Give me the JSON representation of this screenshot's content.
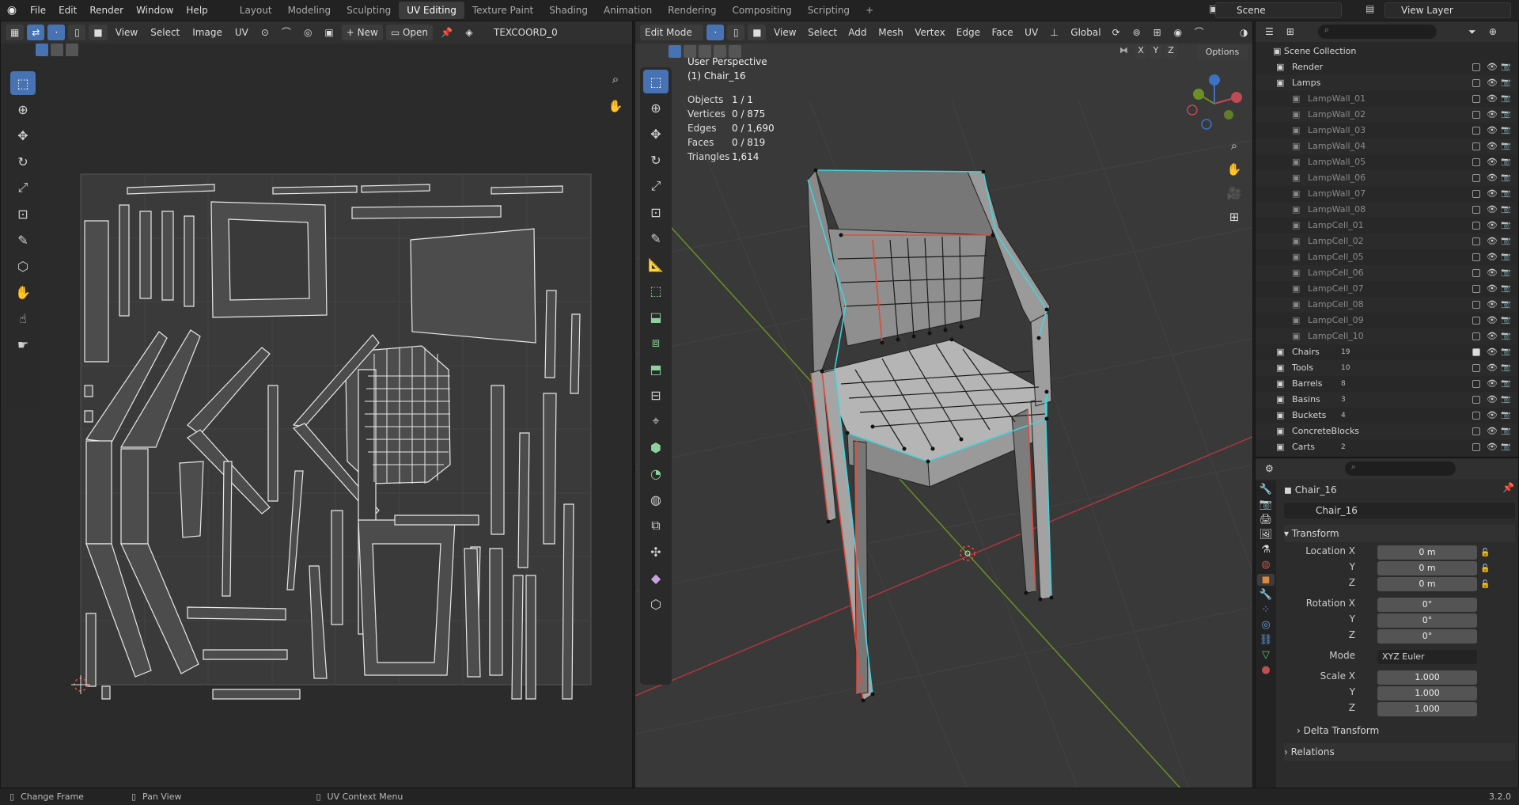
{
  "topbar": {
    "menus": [
      "File",
      "Edit",
      "Render",
      "Window",
      "Help"
    ],
    "workspaces": [
      "Layout",
      "Modeling",
      "Sculpting",
      "UV Editing",
      "Texture Paint",
      "Shading",
      "Animation",
      "Rendering",
      "Compositing",
      "Scripting"
    ],
    "active_workspace": "UV Editing",
    "add_tab": "+",
    "scene": "Scene",
    "view_layer": "View Layer"
  },
  "uv_editor": {
    "menus": [
      "View",
      "Select",
      "Image",
      "UV"
    ],
    "new_label": "New",
    "open_label": "Open",
    "uv_map": "TEXCOORD_0"
  },
  "viewport": {
    "mode": "Edit Mode",
    "menus": [
      "View",
      "Select",
      "Add",
      "Mesh",
      "Vertex",
      "Edge",
      "Face",
      "UV"
    ],
    "orientation": "Global",
    "axes": [
      "X",
      "Y",
      "Z"
    ],
    "options_label": "Options",
    "view_name": "User Perspective",
    "object_name": "(1) Chair_16",
    "stats": [
      {
        "label": "Objects",
        "value": "1 / 1"
      },
      {
        "label": "Vertices",
        "value": "0 / 875"
      },
      {
        "label": "Edges",
        "value": "0 / 1,690"
      },
      {
        "label": "Faces",
        "value": "0 / 819"
      },
      {
        "label": "Triangles",
        "value": "1,614"
      }
    ]
  },
  "outliner": {
    "title": "Scene Collection",
    "items": [
      {
        "label": "Render",
        "indent": 1,
        "count": "",
        "checked": false
      },
      {
        "label": "Lamps",
        "indent": 1,
        "count": "",
        "checked": false
      },
      {
        "label": "LampWall_01",
        "indent": 2,
        "count": "",
        "checked": false
      },
      {
        "label": "LampWall_02",
        "indent": 2,
        "count": "",
        "checked": false
      },
      {
        "label": "LampWall_03",
        "indent": 2,
        "count": "",
        "checked": false
      },
      {
        "label": "LampWall_04",
        "indent": 2,
        "count": "",
        "checked": false
      },
      {
        "label": "LampWall_05",
        "indent": 2,
        "count": "",
        "checked": false
      },
      {
        "label": "LampWall_06",
        "indent": 2,
        "count": "",
        "checked": false
      },
      {
        "label": "LampWall_07",
        "indent": 2,
        "count": "",
        "checked": false
      },
      {
        "label": "LampWall_08",
        "indent": 2,
        "count": "",
        "checked": false
      },
      {
        "label": "LampCell_01",
        "indent": 2,
        "count": "",
        "checked": false
      },
      {
        "label": "LampCell_02",
        "indent": 2,
        "count": "",
        "checked": false
      },
      {
        "label": "LampCell_05",
        "indent": 2,
        "count": "",
        "checked": false
      },
      {
        "label": "LampCell_06",
        "indent": 2,
        "count": "",
        "checked": false
      },
      {
        "label": "LampCell_07",
        "indent": 2,
        "count": "",
        "checked": false
      },
      {
        "label": "LampCell_08",
        "indent": 2,
        "count": "",
        "checked": false
      },
      {
        "label": "LampCell_09",
        "indent": 2,
        "count": "",
        "checked": false
      },
      {
        "label": "LampCell_10",
        "indent": 2,
        "count": "",
        "checked": false
      },
      {
        "label": "Chairs",
        "indent": 1,
        "count": "19",
        "checked": true
      },
      {
        "label": "Tools",
        "indent": 1,
        "count": "10",
        "checked": false
      },
      {
        "label": "Barrels",
        "indent": 1,
        "count": "8",
        "checked": false
      },
      {
        "label": "Basins",
        "indent": 1,
        "count": "3",
        "checked": false
      },
      {
        "label": "Buckets",
        "indent": 1,
        "count": "4",
        "checked": false
      },
      {
        "label": "ConcreteBlocks",
        "indent": 1,
        "count": "",
        "checked": false
      },
      {
        "label": "Carts",
        "indent": 1,
        "count": "2",
        "checked": false
      }
    ]
  },
  "properties": {
    "object_title": "Chair_16",
    "object_field": "Chair_16",
    "transform_label": "Transform",
    "location_label": "Location X",
    "location": [
      "0 m",
      "0 m",
      "0 m"
    ],
    "rotation_label": "Rotation X",
    "rotation": [
      "0°",
      "0°",
      "0°"
    ],
    "mode_label": "Mode",
    "mode_value": "XYZ Euler",
    "scale_label": "Scale X",
    "scale": [
      "1.000",
      "1.000",
      "1.000"
    ],
    "y_label": "Y",
    "z_label": "Z",
    "delta_label": "Delta Transform",
    "relations_label": "Relations"
  },
  "statusbar": {
    "items": [
      "Change Frame",
      "Pan View",
      "UV Context Menu"
    ],
    "version": "3.2.0"
  },
  "colors": {
    "accent": "#4772b3",
    "seam": "#e34b3c",
    "boundary": "#3fd6e0",
    "x_axis": "#b0353f",
    "y_axis": "#6b8f26"
  }
}
